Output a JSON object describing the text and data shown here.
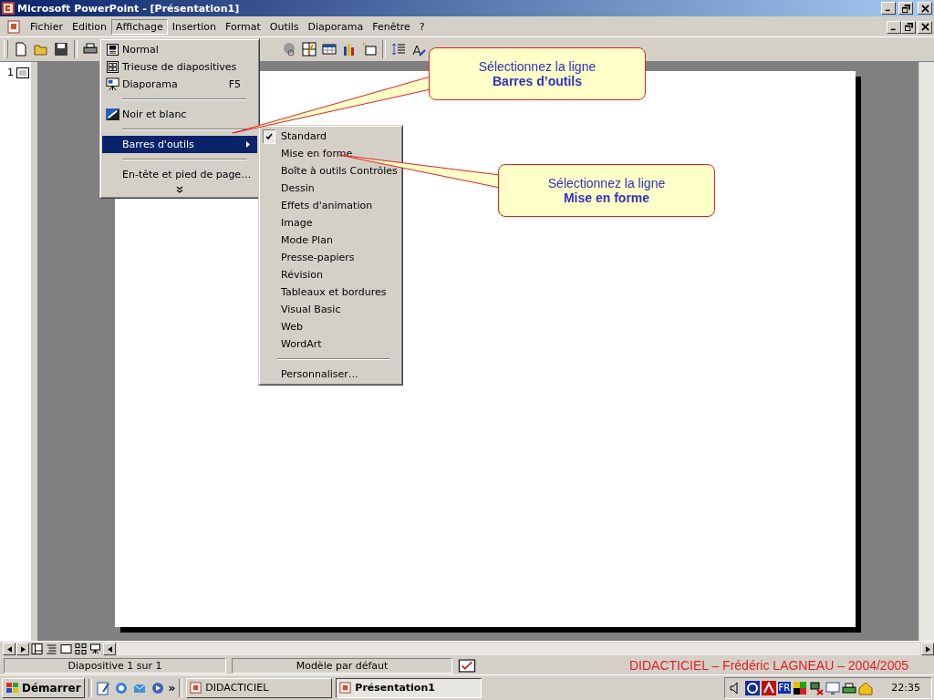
{
  "window": {
    "title": "Microsoft PowerPoint - [Présentation1]"
  },
  "menu_bar": [
    {
      "label": "Fichier",
      "selected": false
    },
    {
      "label": "Edition",
      "selected": false
    },
    {
      "label": "Affichage",
      "selected": true
    },
    {
      "label": "Insertion",
      "selected": false
    },
    {
      "label": "Format",
      "selected": false
    },
    {
      "label": "Outils",
      "selected": false
    },
    {
      "label": "Diaporama",
      "selected": false
    },
    {
      "label": "Fenêtre",
      "selected": false
    },
    {
      "label": "?",
      "selected": false
    }
  ],
  "view_menu": [
    {
      "kind": "item",
      "label": "Normal",
      "selected": false
    },
    {
      "kind": "item",
      "label": "Trieuse de diapositives",
      "selected": false
    },
    {
      "kind": "item",
      "label": "Diaporama",
      "shortcut": "F5",
      "selected": false
    },
    {
      "kind": "separator"
    },
    {
      "kind": "item",
      "label": "Noir et blanc",
      "selected": false
    },
    {
      "kind": "separator"
    },
    {
      "kind": "submenu",
      "label": "Barres d'outils",
      "selected": true
    },
    {
      "kind": "separator"
    },
    {
      "kind": "item",
      "label": "En-tête et pied de page…",
      "selected": false
    },
    {
      "kind": "expand"
    }
  ],
  "toolbars_submenu": [
    {
      "kind": "item",
      "label": "Standard",
      "checked": true
    },
    {
      "kind": "item",
      "label": "Mise en forme",
      "checked": false
    },
    {
      "kind": "item",
      "label": "Boîte à outils Contrôles",
      "checked": false
    },
    {
      "kind": "item",
      "label": "Dessin",
      "checked": false
    },
    {
      "kind": "item",
      "label": "Effets d'animation",
      "checked": false
    },
    {
      "kind": "item",
      "label": "Image",
      "checked": false
    },
    {
      "kind": "item",
      "label": "Mode Plan",
      "checked": false
    },
    {
      "kind": "item",
      "label": "Presse-papiers",
      "checked": false
    },
    {
      "kind": "item",
      "label": "Révision",
      "checked": false
    },
    {
      "kind": "item",
      "label": "Tableaux et bordures",
      "checked": false
    },
    {
      "kind": "item",
      "label": "Visual Basic",
      "checked": false
    },
    {
      "kind": "item",
      "label": "Web",
      "checked": false
    },
    {
      "kind": "item",
      "label": "WordArt",
      "checked": false
    },
    {
      "kind": "separator"
    },
    {
      "kind": "item",
      "label": "Personnaliser…",
      "checked": false
    }
  ],
  "callouts": [
    {
      "line1": "Sélectionnez la ligne",
      "line2": "Barres d’outils"
    },
    {
      "line1": "Sélectionnez la ligne",
      "line2": "Mise en forme"
    }
  ],
  "slide_pane": {
    "number": "1"
  },
  "status_bar": {
    "slide": "Diapositive 1 sur 1",
    "template": "Modèle par défaut",
    "credit": "DIDACTICIEL – Frédéric LAGNEAU – 2004/2005"
  },
  "taskbar": {
    "start": "Démarrer",
    "more": "»",
    "tasks": [
      {
        "label": "DIDACTICIEL",
        "selected": false
      },
      {
        "label": "Présentation1",
        "selected": true
      }
    ],
    "language": "FR",
    "clock": "22:35"
  }
}
